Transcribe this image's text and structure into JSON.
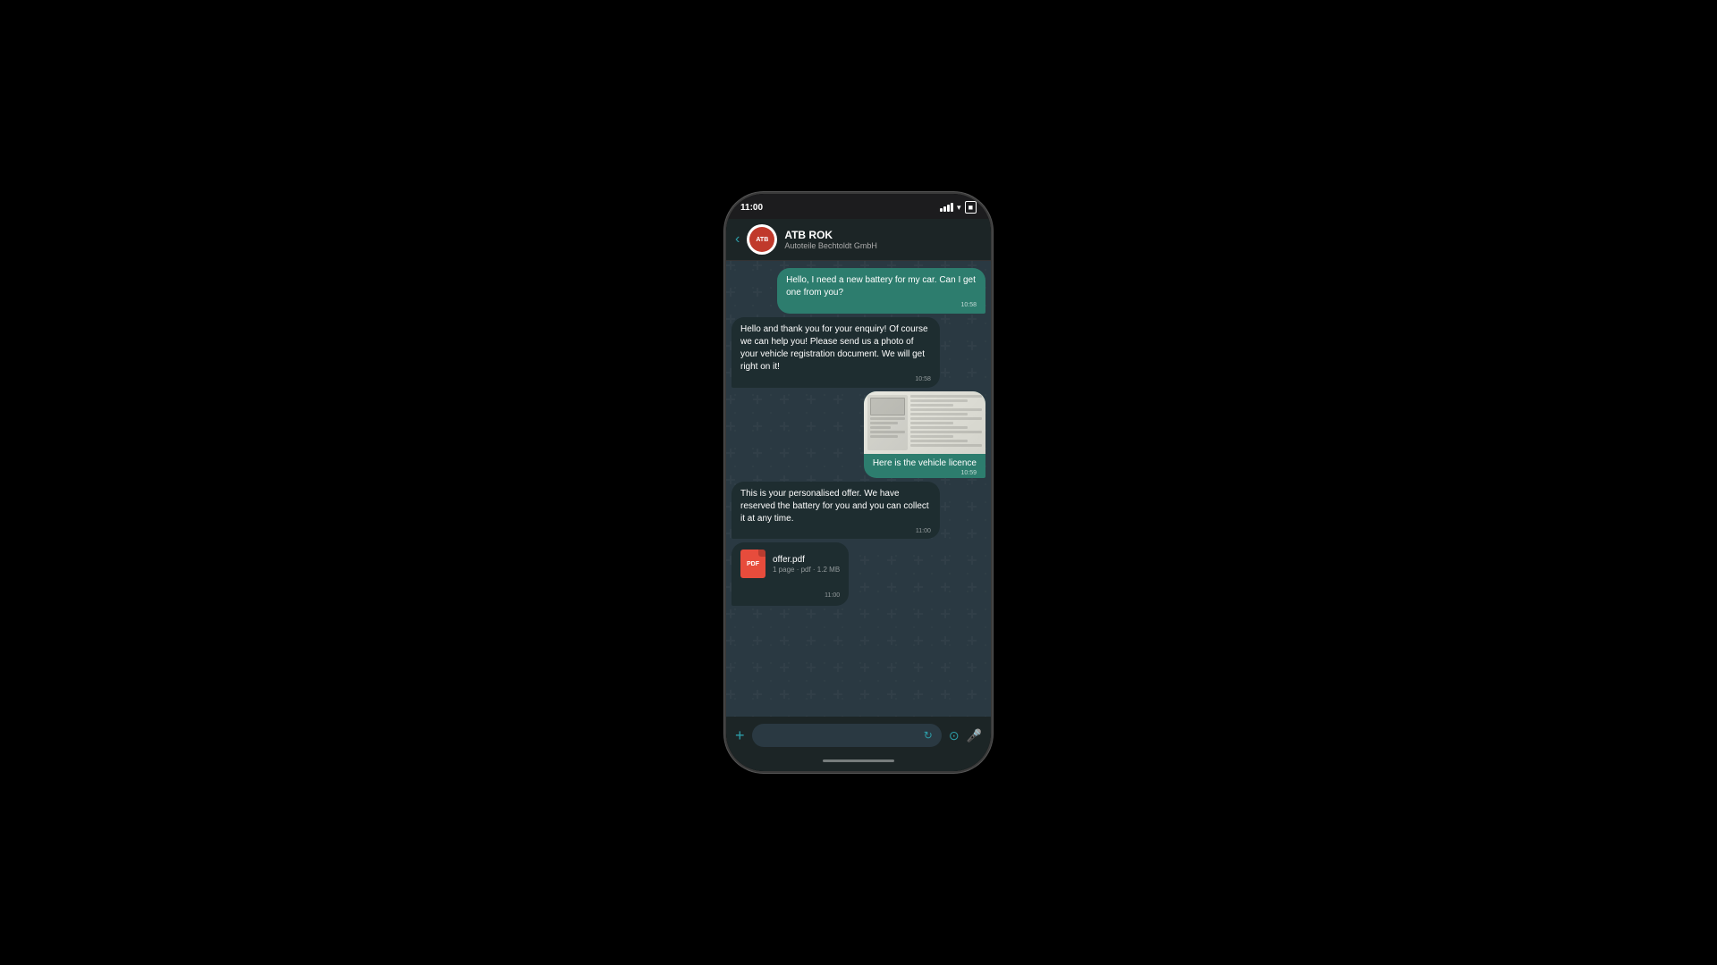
{
  "phone": {
    "status_bar": {
      "time": "11:00"
    },
    "header": {
      "name": "ATB ROK",
      "subtitle": "Autoteile Bechtoldt GmbH",
      "back_label": "‹"
    },
    "messages": [
      {
        "id": "msg1",
        "type": "sent",
        "text": "Hello,\nI need a new battery for my car.\nCan I get one from you?",
        "time": "10:58"
      },
      {
        "id": "msg2",
        "type": "received",
        "text": "Hello and thank you for your enquiry!\nOf course we can help you!\nPlease send us a photo of your vehicle registration document. We will get right on it!",
        "time": "10:58"
      },
      {
        "id": "msg3",
        "type": "sent-image",
        "caption": "Here is the vehicle licence",
        "time": "10:59"
      },
      {
        "id": "msg4",
        "type": "received",
        "text": "This is your personalised offer. We have reserved the battery for you and you can collect it at any time.",
        "time": "11:00"
      },
      {
        "id": "msg5",
        "type": "received-pdf",
        "filename": "offer.pdf",
        "meta": "1 page · pdf · 1.2 MB",
        "time": "11:00"
      }
    ],
    "input_bar": {
      "placeholder": ""
    }
  }
}
